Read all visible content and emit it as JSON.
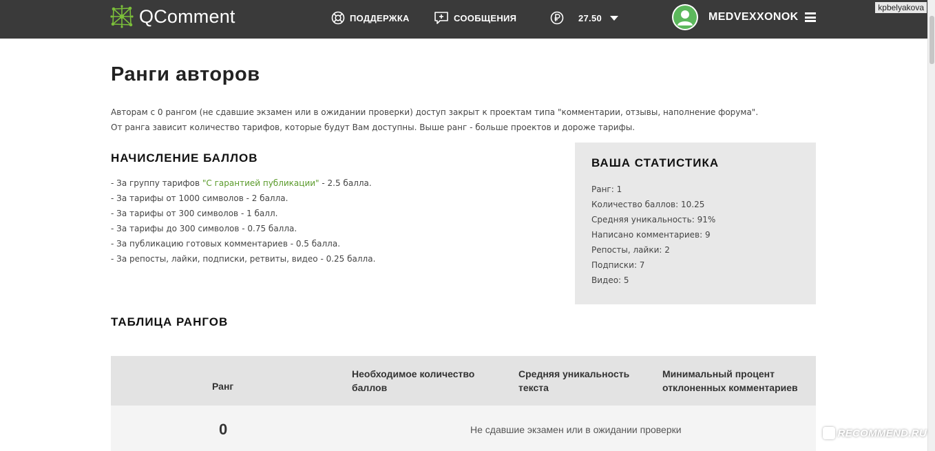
{
  "header": {
    "logo_text": "QComment",
    "support_label": "ПОДДЕРЖКА",
    "messages_label": "СООБЩЕНИЯ",
    "balance": "27.50",
    "username": "MEDVEXXONOK",
    "watermark_user": "kpbelyakova",
    "colors": {
      "bar": "#3a3a3a",
      "logo_accent": "#7bbf3a"
    }
  },
  "page": {
    "title": "Ранги авторов",
    "intro": [
      "Авторам с 0 рангом (не сдавшие экзамен или в ожидании проверки) доступ закрыт к проектам типа \"комментарии, отзывы, наполнение форума\".",
      "От ранга зависит количество тарифов, которые будут Вам доступны. Выше ранг - больше проектов и дороже тарифы."
    ]
  },
  "points": {
    "heading": "НАЧИСЛЕНИЕ БАЛЛОВ",
    "first_item": {
      "prefix": "- За группу тарифов ",
      "link": "\"С гарантией публикации\"",
      "suffix": " - 2.5 балла."
    },
    "items": [
      "- За тарифы от 1000 символов - 2 балла.",
      "- За тарифы от 300 символов - 1 балл.",
      "- За тарифы до 300 символов - 0.75 балла.",
      "- За публикацию готовых комментариев - 0.5 балла.",
      "- За репосты, лайки, подписки, ретвиты, видео - 0.25 балла."
    ]
  },
  "stats": {
    "heading": "ВАША СТАТИСТИКА",
    "items": [
      "Ранг: 1",
      "Количество баллов: 10.25",
      "Средняя уникальность: 91%",
      "Написано комментариев: 9",
      "Репосты, лайки: 2",
      "Подписки: 7",
      "Видео: 5"
    ]
  },
  "ranks": {
    "heading": "ТАБЛИЦА РАНГОВ",
    "columns": [
      "Ранг",
      "Необходимое количество баллов",
      "Средняя уникальность текста",
      "Минимальный процент отклоненных комментариев"
    ],
    "rows": [
      {
        "rank": "0",
        "description": "Не сдавшие экзамен или в ожидании проверки"
      }
    ]
  },
  "watermark": {
    "site": "RECOMMEND.RU"
  }
}
